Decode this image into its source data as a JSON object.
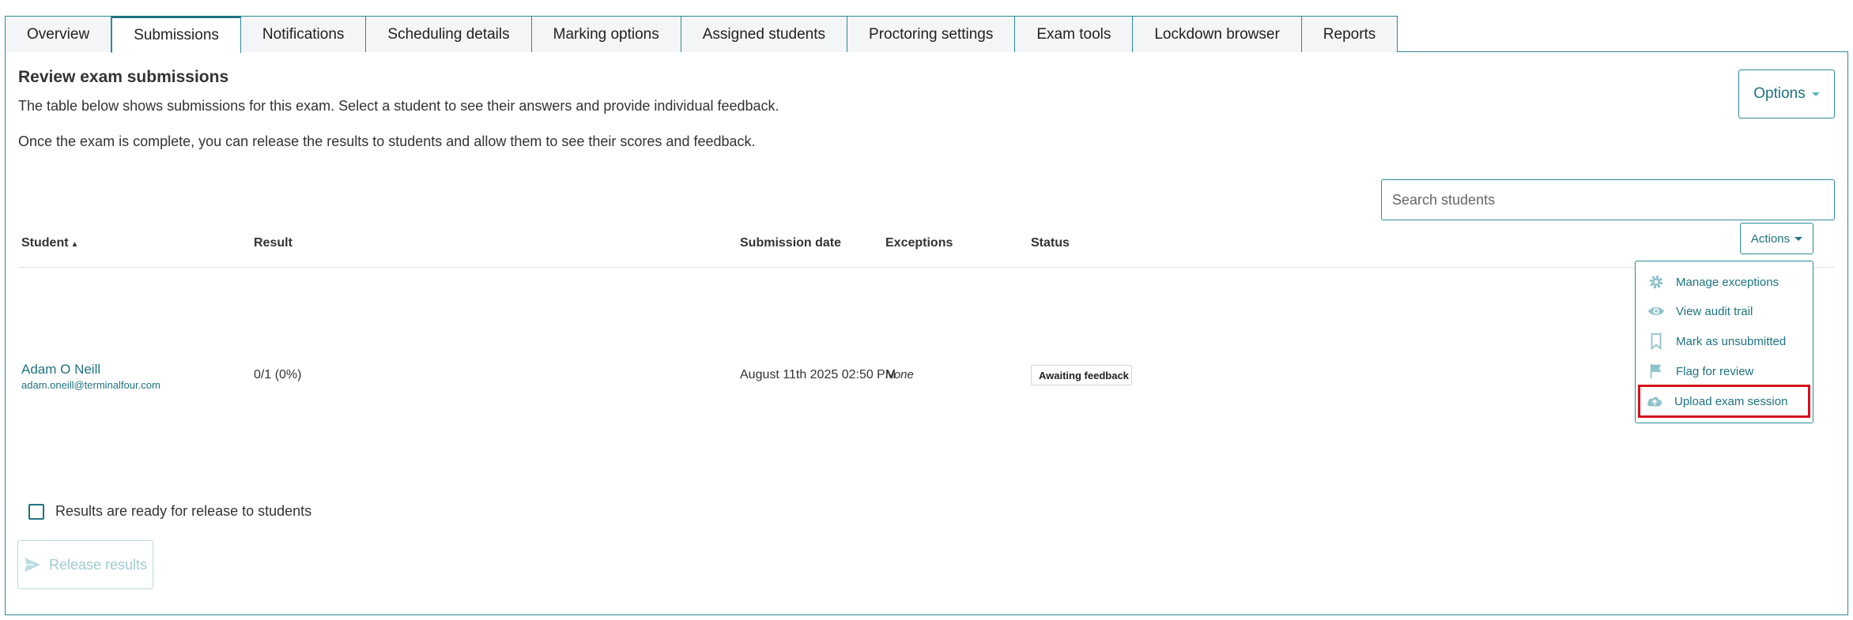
{
  "tabs": [
    {
      "label": "Overview"
    },
    {
      "label": "Submissions"
    },
    {
      "label": "Notifications"
    },
    {
      "label": "Scheduling details"
    },
    {
      "label": "Marking options"
    },
    {
      "label": "Assigned students"
    },
    {
      "label": "Proctoring settings"
    },
    {
      "label": "Exam tools"
    },
    {
      "label": "Lockdown browser"
    },
    {
      "label": "Reports"
    }
  ],
  "active_tab": "Submissions",
  "page": {
    "title": "Review exam submissions",
    "description1": "The table below shows submissions for this exam. Select a student to see their answers and provide individual feedback.",
    "description2": "Once the exam is complete, you can release the results to students and allow them to see their scores and feedback.",
    "options_label": "Options"
  },
  "search": {
    "placeholder": "Search students",
    "value": ""
  },
  "table": {
    "headers": {
      "student": "Student",
      "student_sort": "▲",
      "result": "Result",
      "submission_date": "Submission date",
      "exceptions": "Exceptions",
      "status": "Status"
    },
    "rows": [
      {
        "name": "Adam O Neill",
        "email": "adam.oneill@terminalfour.com",
        "result": "0/1 (0%)",
        "submission_date": "August 11th 2025 02:50 PM",
        "exceptions": "None",
        "status": "Awaiting feedback"
      }
    ]
  },
  "actions": {
    "label": "Actions",
    "menu": [
      {
        "label": "Manage exceptions",
        "icon": "gear-icon"
      },
      {
        "label": "View audit trail",
        "icon": "eye-icon"
      },
      {
        "label": "Mark as unsubmitted",
        "icon": "bookmark-icon"
      },
      {
        "label": "Flag for review",
        "icon": "flag-icon"
      },
      {
        "label": "Upload exam session",
        "icon": "cloud-upload-icon",
        "highlighted": true
      }
    ]
  },
  "release": {
    "checkbox_label": "Results are ready for release to students",
    "checked": false,
    "button_label": "Release results",
    "button_enabled": false
  },
  "colors": {
    "accent": "#1d7381",
    "border": "#2c8a9a",
    "highlight": "#d4111b",
    "icon": "#8fc3cb"
  }
}
